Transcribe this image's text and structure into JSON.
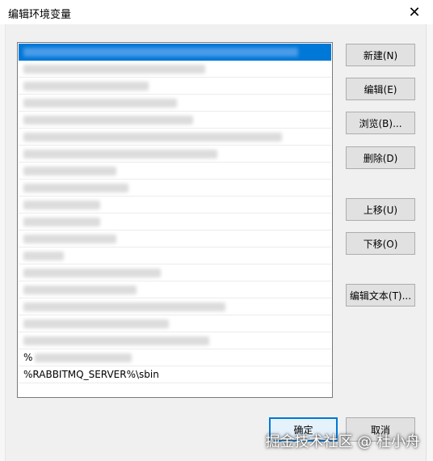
{
  "window": {
    "title": "编辑环境变量",
    "close_glyph": "✕"
  },
  "list": {
    "visible_entry": "%RABBITMQ_SERVER%\\sbin",
    "partial_entry": "%"
  },
  "buttons": {
    "new": "新建(N)",
    "edit": "编辑(E)",
    "browse": "浏览(B)...",
    "delete": "删除(D)",
    "move_up": "上移(U)",
    "move_down": "下移(O)",
    "edit_text": "编辑文本(T)...",
    "ok": "确定",
    "cancel": "取消"
  },
  "watermark": "掘金技术社区 @ 杜小舟",
  "colors": {
    "selection": "#0078d7",
    "default_button_border": "#0078d7"
  }
}
